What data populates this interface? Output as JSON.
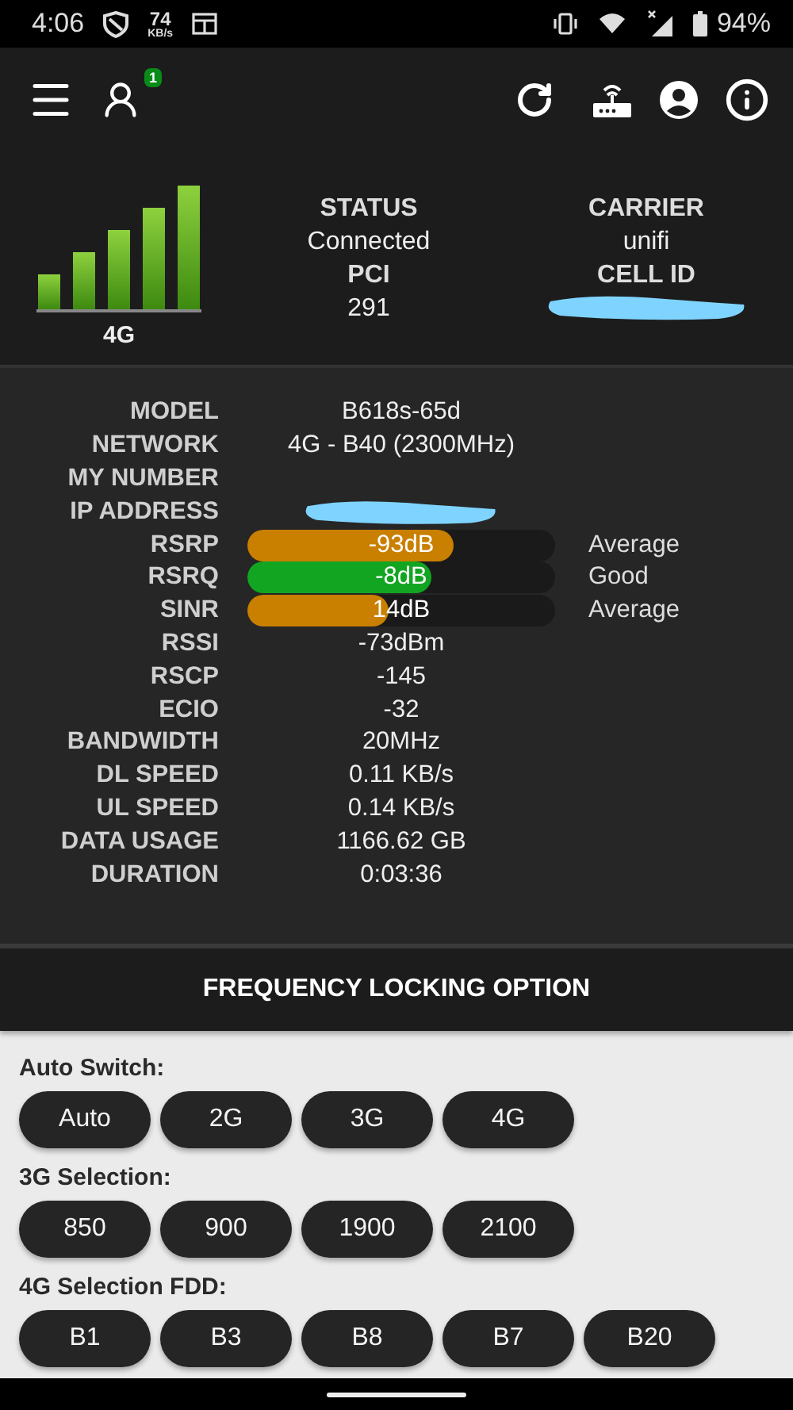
{
  "status_bar": {
    "time": "4:06",
    "speed_value": "74",
    "speed_unit": "KB/s",
    "battery": "94%"
  },
  "app_bar": {
    "badge": "1"
  },
  "summary": {
    "network_type": "4G",
    "columns": [
      {
        "items": [
          {
            "label": "STATUS",
            "value": "Connected"
          },
          {
            "label": "PCI",
            "value": "291"
          }
        ]
      },
      {
        "items": [
          {
            "label": "CARRIER",
            "value": "unifi"
          },
          {
            "label": "CELL ID",
            "redacted": true
          }
        ]
      }
    ]
  },
  "details": [
    {
      "kind": "text",
      "label": "MODEL",
      "value": "B618s-65d"
    },
    {
      "kind": "text",
      "label": "NETWORK",
      "value": "4G - B40 (2300MHz)"
    },
    {
      "kind": "text",
      "label": "MY NUMBER"
    },
    {
      "kind": "redacted",
      "label": "IP ADDRESS"
    },
    {
      "kind": "meter",
      "label": "RSRP",
      "value": "-93dB",
      "level": 0.67,
      "color": "#c97f00",
      "rating": "Average"
    },
    {
      "kind": "meter",
      "label": "RSRQ",
      "value": "-8dB",
      "level": 0.6,
      "color": "#12a521",
      "rating": "Good"
    },
    {
      "kind": "meter",
      "label": "SINR",
      "value": "14dB",
      "level": 0.46,
      "color": "#c97f00",
      "rating": "Average"
    },
    {
      "kind": "text",
      "label": "RSSI",
      "value": "-73dBm"
    },
    {
      "kind": "text",
      "label": "RSCP",
      "value": "-145"
    },
    {
      "kind": "text",
      "label": "ECIO",
      "value": "-32"
    },
    {
      "kind": "text",
      "label": "BANDWIDTH",
      "value": "20MHz"
    },
    {
      "kind": "text",
      "label": "DL SPEED",
      "value": "0.11 KB/s"
    },
    {
      "kind": "text",
      "label": "UL SPEED",
      "value": "0.14 KB/s"
    },
    {
      "kind": "text",
      "label": "DATA USAGE",
      "value": "1166.62 GB"
    },
    {
      "kind": "text",
      "label": "DURATION",
      "value": "0:03:36"
    }
  ],
  "frequency_locking": {
    "title": "FREQUENCY LOCKING OPTION",
    "groups": [
      {
        "label": "Auto Switch:",
        "options": [
          "Auto",
          "2G",
          "3G",
          "4G"
        ]
      },
      {
        "label": "3G Selection:",
        "options": [
          "850",
          "900",
          "1900",
          "2100"
        ]
      },
      {
        "label": "4G Selection FDD:",
        "options": [
          "B1",
          "B3",
          "B8",
          "B7",
          "B20"
        ]
      }
    ]
  }
}
